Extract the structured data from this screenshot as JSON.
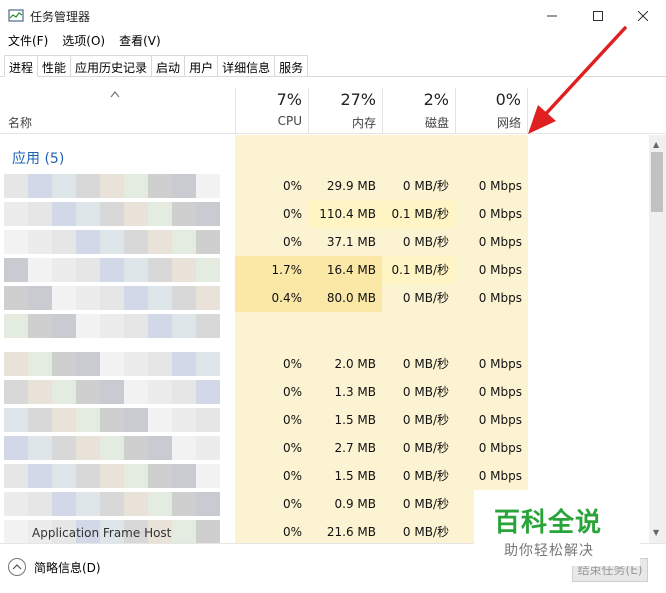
{
  "window": {
    "title": "任务管理器"
  },
  "menu": [
    "文件(F)",
    "选项(O)",
    "查看(V)"
  ],
  "tabs": [
    "进程",
    "性能",
    "应用历史记录",
    "启动",
    "用户",
    "详细信息",
    "服务"
  ],
  "columns": {
    "name": "名称",
    "cpu": {
      "percent": "7%",
      "label": "CPU"
    },
    "memory": {
      "percent": "27%",
      "label": "内存"
    },
    "disk": {
      "percent": "2%",
      "label": "磁盘"
    },
    "network": {
      "percent": "0%",
      "label": "网络"
    }
  },
  "section": {
    "title": "应用 (5)"
  },
  "rows": [
    {
      "cpu": "0%",
      "mem": "29.9 MB",
      "disk": "0 MB/秒",
      "net": "0 Mbps"
    },
    {
      "cpu": "0%",
      "mem": "110.4 MB",
      "disk": "0.1 MB/秒",
      "net": "0 Mbps"
    },
    {
      "cpu": "0%",
      "mem": "37.1 MB",
      "disk": "0 MB/秒",
      "net": "0 Mbps"
    },
    {
      "cpu": "1.7%",
      "mem": "16.4 MB",
      "disk": "0.1 MB/秒",
      "net": "0 Mbps"
    },
    {
      "cpu": "0.4%",
      "mem": "80.0 MB",
      "disk": "0 MB/秒",
      "net": "0 Mbps"
    },
    {
      "cpu": "",
      "mem": "",
      "disk": "",
      "net": ""
    },
    {
      "cpu": "0%",
      "mem": "2.0 MB",
      "disk": "0 MB/秒",
      "net": "0 Mbps"
    },
    {
      "cpu": "0%",
      "mem": "1.3 MB",
      "disk": "0 MB/秒",
      "net": "0 Mbps"
    },
    {
      "cpu": "0%",
      "mem": "1.5 MB",
      "disk": "0 MB/秒",
      "net": "0 Mbps"
    },
    {
      "cpu": "0%",
      "mem": "2.7 MB",
      "disk": "0 MB/秒",
      "net": "0 Mbps"
    },
    {
      "cpu": "0%",
      "mem": "1.5 MB",
      "disk": "0 MB/秒",
      "net": "0 Mbps"
    },
    {
      "cpu": "0%",
      "mem": "0.9 MB",
      "disk": "0 MB/秒",
      "net": "0 Mbps"
    },
    {
      "cpu": "0%",
      "mem": "21.6 MB",
      "disk": "0 MB/秒",
      "net": "0 Mbps"
    }
  ],
  "partial_row_name": "Application Frame Host",
  "footer": {
    "fewer_details": "简略信息(D)",
    "end_task": "结束任务(E)"
  },
  "watermark": {
    "main": "百科全说",
    "sub": "助你轻松解决"
  },
  "colors": {
    "section": "#1e64b4",
    "column_tint": "#fcf3d2",
    "highlight": "#fbe8a6",
    "arrow": "#e02020",
    "watermark_green": "#2aa43a"
  }
}
